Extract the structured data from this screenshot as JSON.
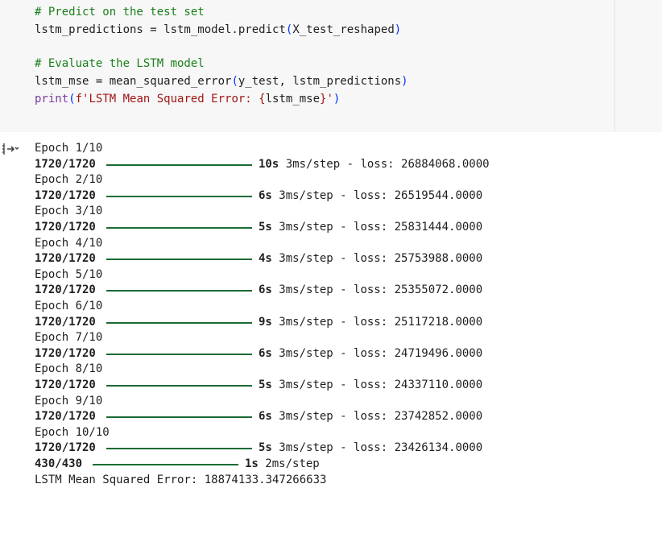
{
  "code": {
    "comment1": "# Predict on the test set",
    "line2_a": "lstm_predictions = lstm_model.predict",
    "line2_open": "(",
    "line2_arg": "X_test_reshaped",
    "line2_close": ")",
    "comment2": "# Evaluate the LSTM model",
    "line4_a": "lstm_mse = mean_squared_error",
    "line4_open": "(",
    "line4_args": "y_test, lstm_predictions",
    "line4_close": ")",
    "print_kw": "print",
    "print_open": "(",
    "print_str_a": "f'LSTM Mean Squared Error: ",
    "print_brace_open": "{",
    "print_var": "lstm_mse",
    "print_brace_close": "}",
    "print_str_b": "'",
    "print_close": ")"
  },
  "output": {
    "icon": "output-toggle-icon",
    "epochs": [
      {
        "label": "Epoch 1/10",
        "steps": "1720/1720",
        "progress": 1.0,
        "time": "10s",
        "rest": "3ms/step - loss: 26884068.0000"
      },
      {
        "label": "Epoch 2/10",
        "steps": "1720/1720",
        "progress": 1.0,
        "time": "6s",
        "rest": "3ms/step - loss: 26519544.0000"
      },
      {
        "label": "Epoch 3/10",
        "steps": "1720/1720",
        "progress": 1.0,
        "time": "5s",
        "rest": "3ms/step - loss: 25831444.0000"
      },
      {
        "label": "Epoch 4/10",
        "steps": "1720/1720",
        "progress": 1.0,
        "time": "4s",
        "rest": "3ms/step - loss: 25753988.0000"
      },
      {
        "label": "Epoch 5/10",
        "steps": "1720/1720",
        "progress": 1.0,
        "time": "6s",
        "rest": "3ms/step - loss: 25355072.0000"
      },
      {
        "label": "Epoch 6/10",
        "steps": "1720/1720",
        "progress": 1.0,
        "time": "9s",
        "rest": "3ms/step - loss: 25117218.0000"
      },
      {
        "label": "Epoch 7/10",
        "steps": "1720/1720",
        "progress": 1.0,
        "time": "6s",
        "rest": "3ms/step - loss: 24719496.0000"
      },
      {
        "label": "Epoch 8/10",
        "steps": "1720/1720",
        "progress": 1.0,
        "time": "5s",
        "rest": "3ms/step - loss: 24337110.0000"
      },
      {
        "label": "Epoch 9/10",
        "steps": "1720/1720",
        "progress": 1.0,
        "time": "6s",
        "rest": "3ms/step - loss: 23742852.0000"
      },
      {
        "label": "Epoch 10/10",
        "steps": "1720/1720",
        "progress": 1.0,
        "time": "5s",
        "rest": "3ms/step - loss: 23426134.0000"
      }
    ],
    "predict": {
      "steps": "430/430",
      "progress": 1.0,
      "time": "1s",
      "rest": "2ms/step"
    },
    "mse": "LSTM Mean Squared Error: 18874133.347266633"
  }
}
